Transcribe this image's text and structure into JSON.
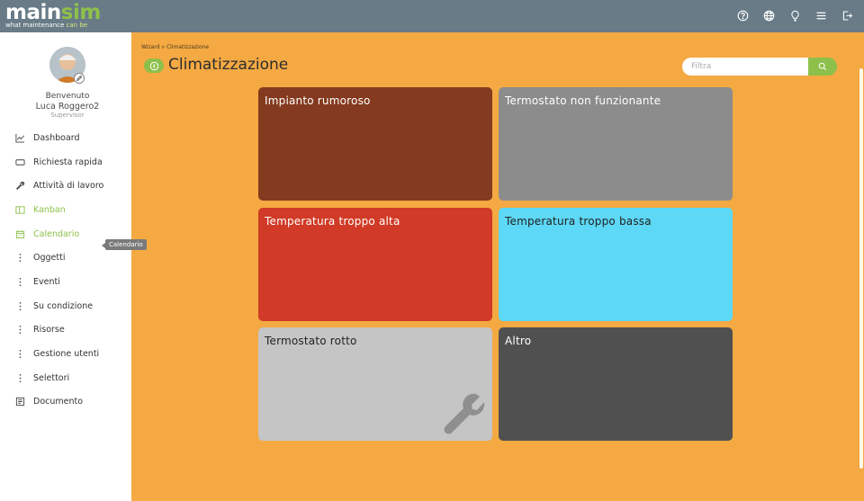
{
  "app": {
    "logo_main": "main",
    "logo_sim": "sim",
    "logo_tag_a": "what maintenance",
    "logo_tag_b": "can be"
  },
  "topbar_icons": [
    "help-icon",
    "globe-icon",
    "lightbulb-icon",
    "menu-icon",
    "logout-icon"
  ],
  "user": {
    "welcome": "Benvenuto",
    "name": "Luca Roggero2",
    "role": "Supervisor"
  },
  "sidebar": {
    "items": [
      {
        "label": "Dashboard",
        "icon": "chart-icon"
      },
      {
        "label": "Richiesta rapida",
        "icon": "rectangle-icon"
      },
      {
        "label": "Attività di lavoro",
        "icon": "wrench-icon"
      },
      {
        "label": "Kanban",
        "icon": "kanban-icon"
      },
      {
        "label": "Calendario",
        "icon": "calendar-icon"
      },
      {
        "label": "Oggetti",
        "icon": "dots-icon"
      },
      {
        "label": "Eventi",
        "icon": "dots-icon"
      },
      {
        "label": "Su condizione",
        "icon": "dots-icon"
      },
      {
        "label": "Risorse",
        "icon": "dots-icon"
      },
      {
        "label": "Gestione utenti",
        "icon": "dots-icon"
      },
      {
        "label": "Selettori",
        "icon": "dots-icon"
      },
      {
        "label": "Documento",
        "icon": "document-icon"
      }
    ],
    "tooltip": "Calendario"
  },
  "breadcrumb": {
    "root": "Wizard",
    "sep": "»",
    "current": "Climatizzazione"
  },
  "page": {
    "title": "Climatizzazione"
  },
  "filter": {
    "placeholder": "Filtra"
  },
  "cards": [
    {
      "label": "Impianto rumoroso",
      "color": "#843a1e"
    },
    {
      "label": "Termostato non funzionante",
      "color": "#8c8c8c"
    },
    {
      "label": "Temperatura troppo alta",
      "color": "#d13a26"
    },
    {
      "label": "Temperatura troppo bassa",
      "color": "#5dd8f6"
    },
    {
      "label": "Termostato rotto",
      "color": "#c5c5c5"
    },
    {
      "label": "Altro",
      "color": "#505050"
    }
  ],
  "colors": {
    "accent": "#8dc04a",
    "topbar": "#687b87",
    "background": "#f4a942"
  }
}
